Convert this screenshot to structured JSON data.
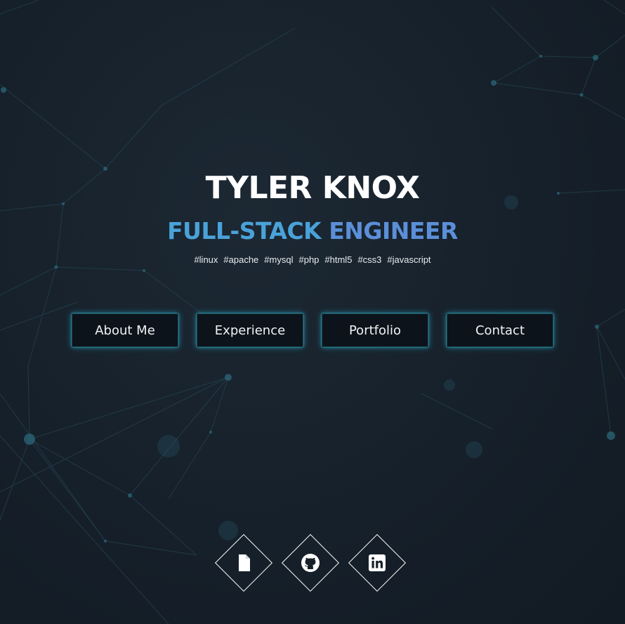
{
  "hero": {
    "name": "TYLER KNOX",
    "role_part1": "FULL-STACK",
    "role_part2": "ENGINEER",
    "tags": [
      "#linux",
      "#apache",
      "#mysql",
      "#php",
      "#html5",
      "#css3",
      "#javascript"
    ]
  },
  "nav": {
    "items": [
      {
        "label": "About Me"
      },
      {
        "label": "Experience"
      },
      {
        "label": "Portfolio"
      },
      {
        "label": "Contact"
      }
    ]
  },
  "socials": [
    {
      "icon": "document-icon"
    },
    {
      "icon": "github-icon"
    },
    {
      "icon": "linkedin-icon"
    }
  ],
  "colors": {
    "background": "#172029",
    "role_blue": "#4aa2d9",
    "role_blue_2": "#5b8fd8",
    "button_glow": "#2bafc8",
    "network_lines": "#2a5466"
  }
}
